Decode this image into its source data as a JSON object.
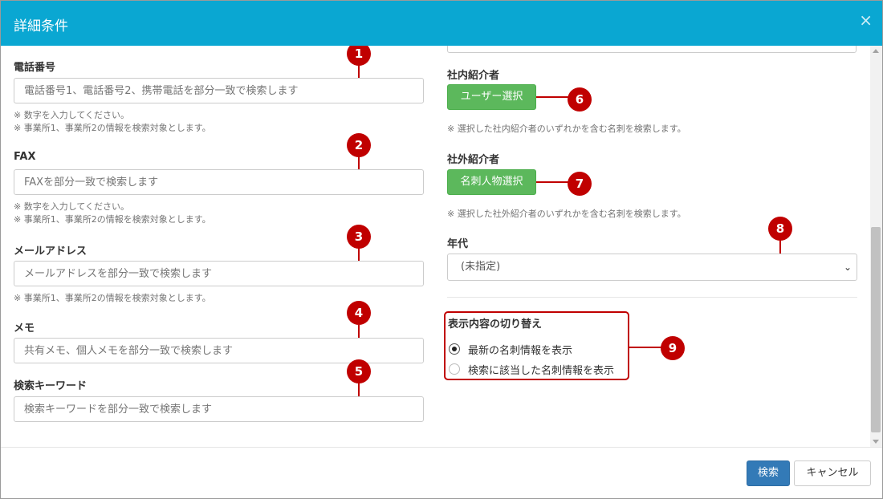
{
  "header": {
    "title": "詳細条件",
    "close_icon": "×"
  },
  "left": {
    "phone": {
      "label": "電話番号",
      "placeholder": "電話番号1、電話番号2、携帯電話を部分一致で検索します",
      "help": [
        "※ 数字を入力してください。",
        "※ 事業所1、事業所2の情報を検索対象とします。"
      ]
    },
    "fax": {
      "label": "FAX",
      "placeholder": "FAXを部分一致で検索します",
      "help": [
        "※ 数字を入力してください。",
        "※ 事業所1、事業所2の情報を検索対象とします。"
      ]
    },
    "email": {
      "label": "メールアドレス",
      "placeholder": "メールアドレスを部分一致で検索します",
      "help": [
        "※ 事業所1、事業所2の情報を検索対象とします。"
      ]
    },
    "memo": {
      "label": "メモ",
      "placeholder": "共有メモ、個人メモを部分一致で検索します"
    },
    "keyword": {
      "label": "検索キーワード",
      "placeholder": "検索キーワードを部分一致で検索します"
    }
  },
  "right": {
    "internal": {
      "label": "社内紹介者",
      "button": "ユーザー選択",
      "help": "※ 選択した社内紹介者のいずれかを含む名刺を検索します。"
    },
    "external": {
      "label": "社外紹介者",
      "button": "名刺人物選択",
      "help": "※ 選択した社外紹介者のいずれかを含む名刺を検索します。"
    },
    "age": {
      "label": "年代",
      "selected": "(未指定)"
    },
    "display": {
      "label": "表示内容の切り替え",
      "options": [
        {
          "label": "最新の名刺情報を表示",
          "checked": true
        },
        {
          "label": "検索に該当した名刺情報を表示",
          "checked": false
        }
      ]
    }
  },
  "callouts": [
    "1",
    "2",
    "3",
    "4",
    "5",
    "6",
    "7",
    "8",
    "9"
  ],
  "footer": {
    "search": "検索",
    "cancel": "キャンセル"
  },
  "colors": {
    "header": "#0aa7d2",
    "callout": "#c00000",
    "green": "#5cb85c",
    "primary": "#337ab7"
  }
}
